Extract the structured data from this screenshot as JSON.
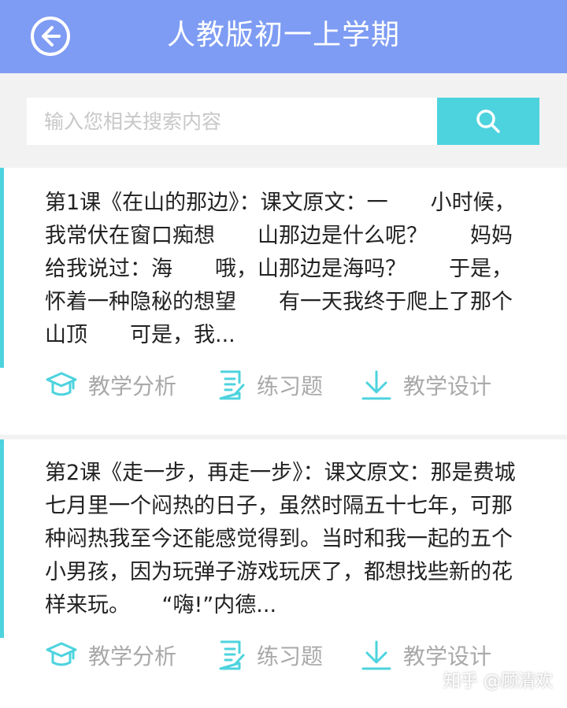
{
  "header": {
    "title": "人教版初一上学期",
    "back_icon": "back-arrow-circle-icon"
  },
  "search": {
    "placeholder": "输入您相关搜索内容",
    "button_icon": "search-icon"
  },
  "lessons": [
    {
      "text": "第1课《在山的那边》：课文原文：一　　小时候，我常伏在窗口痴想　　山那边是什么呢？　　妈妈给我说过：海　　哦，山那边是海吗？　　于是，怀着一种隐秘的想望　　有一天我终于爬上了那个山顶　　可是，我...",
      "actions": [
        {
          "label": "教学分析",
          "icon": "mortarboard-icon"
        },
        {
          "label": "练习题",
          "icon": "list-document-icon"
        },
        {
          "label": "教学设计",
          "icon": "download-icon"
        }
      ]
    },
    {
      "text": "第2课《走一步，再走一步》：课文原文：那是费城七月里一个闷热的日子，虽然时隔五十七年，可那种闷热我至今还能感觉得到。当时和我一起的五个小男孩，因为玩弹子游戏玩厌了，都想找些新的花样来玩。　　“嗨!”内德...",
      "actions": [
        {
          "label": "教学分析",
          "icon": "mortarboard-icon"
        },
        {
          "label": "练习题",
          "icon": "list-document-icon"
        },
        {
          "label": "教学设计",
          "icon": "download-icon"
        }
      ]
    }
  ],
  "watermark": "知乎 @顾清欢",
  "colors": {
    "header": "#7e9cf3",
    "accent": "#4dd3de",
    "muted_text": "#a9a9a9"
  }
}
